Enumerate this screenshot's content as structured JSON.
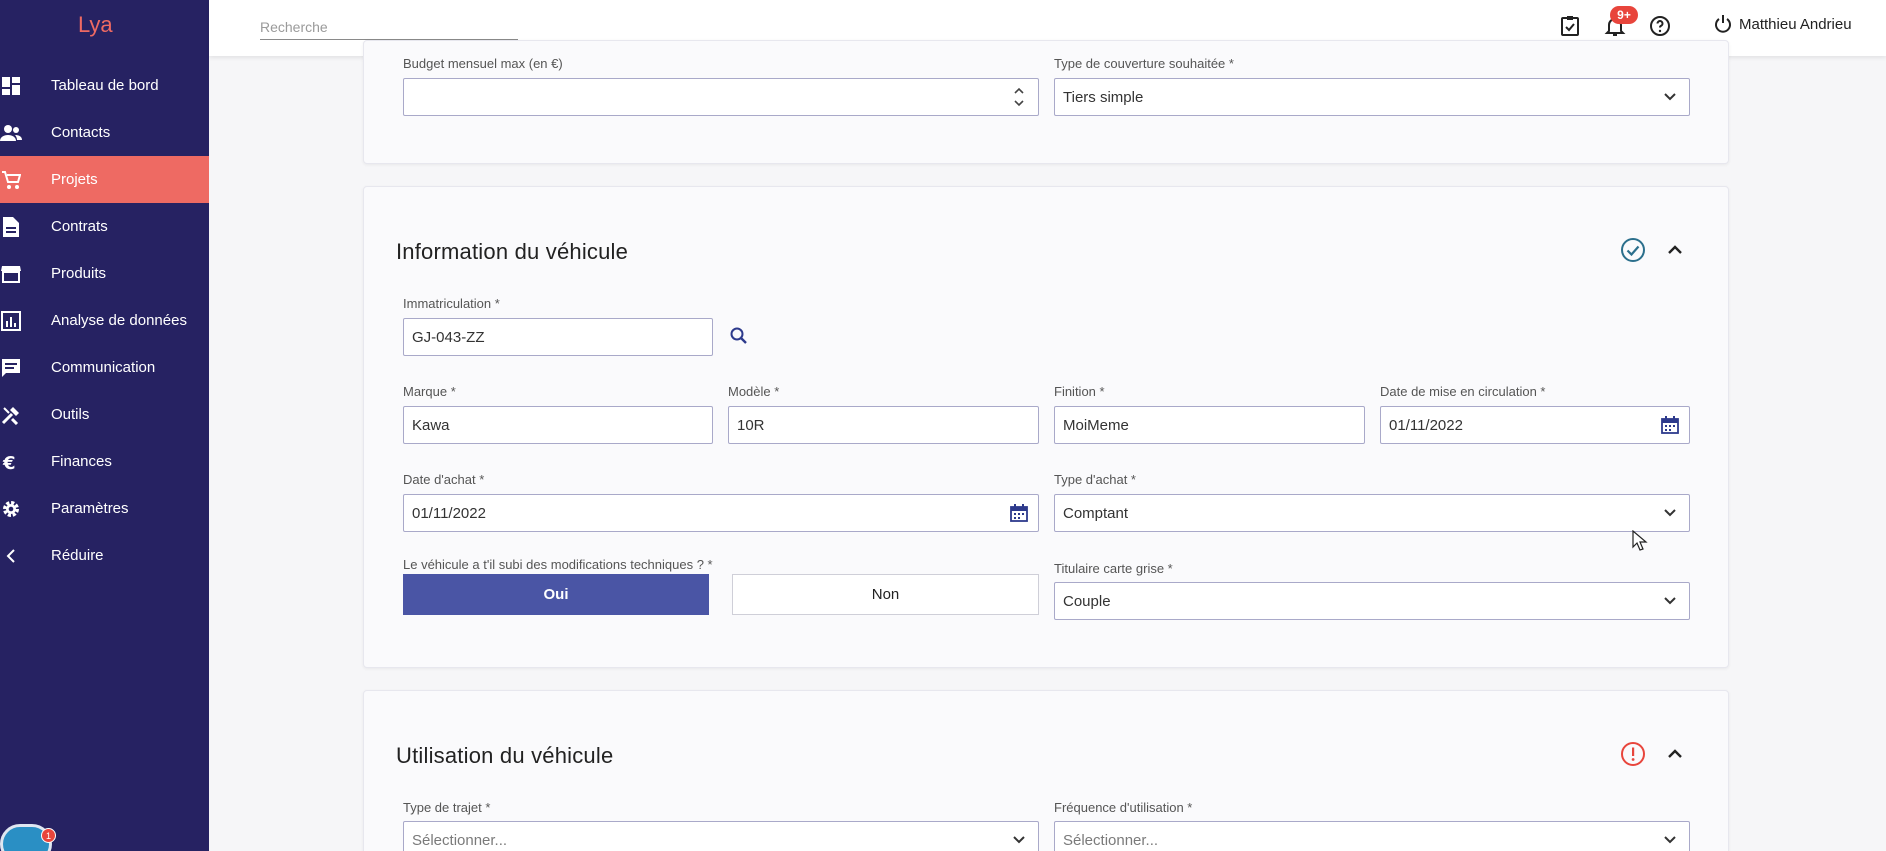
{
  "app": {
    "logo_text": "Lya"
  },
  "sidebar": {
    "items": [
      {
        "label": "Tableau de bord",
        "icon": "dashboard-icon"
      },
      {
        "label": "Contacts",
        "icon": "people-icon"
      },
      {
        "label": "Projets",
        "icon": "cart-icon"
      },
      {
        "label": "Contrats",
        "icon": "document-icon"
      },
      {
        "label": "Produits",
        "icon": "store-icon"
      },
      {
        "label": "Analyse de données",
        "icon": "chart-icon"
      },
      {
        "label": "Communication",
        "icon": "message-icon"
      },
      {
        "label": "Outils",
        "icon": "tools-icon"
      },
      {
        "label": "Finances",
        "icon": "euro-icon"
      },
      {
        "label": "Paramètres",
        "icon": "gear-icon"
      }
    ],
    "reduce_label": "Réduire",
    "chat_badge": "1"
  },
  "topbar": {
    "search_placeholder": "Recherche",
    "notif_badge": "9+",
    "user_name": "Matthieu Andrieu"
  },
  "budget_section": {
    "budget_label": "Budget mensuel max (en €)",
    "budget_value": "",
    "coverage_label": "Type de couverture souhaitée *",
    "coverage_value": "Tiers simple"
  },
  "vehicle_info": {
    "title": "Information du véhicule",
    "immat_label": "Immatriculation *",
    "immat_value": "GJ-043-ZZ",
    "marque_label": "Marque *",
    "marque_value": "Kawa",
    "modele_label": "Modèle *",
    "modele_value": "10R",
    "finition_label": "Finition *",
    "finition_value": "MoiMeme",
    "circulation_label": "Date de mise en circulation *",
    "circulation_value": "01/11/2022",
    "achat_date_label": "Date d'achat *",
    "achat_date_value": "01/11/2022",
    "achat_type_label": "Type d'achat *",
    "achat_type_value": "Comptant",
    "modif_label": "Le véhicule a t'il subi des modifications techniques ? *",
    "oui_label": "Oui",
    "non_label": "Non",
    "titulaire_label": "Titulaire carte grise *",
    "titulaire_value": "Couple"
  },
  "vehicle_usage": {
    "title": "Utilisation du véhicule",
    "trajet_label": "Type de trajet *",
    "trajet_placeholder": "Sélectionner...",
    "frequence_label": "Fréquence d'utilisation *",
    "frequence_placeholder": "Sélectionner..."
  },
  "colors": {
    "sidebar": "#262262",
    "active": "#ee6a63",
    "primary": "#4a55a5",
    "ok": "#2b6f8c",
    "warn": "#e8453c"
  }
}
